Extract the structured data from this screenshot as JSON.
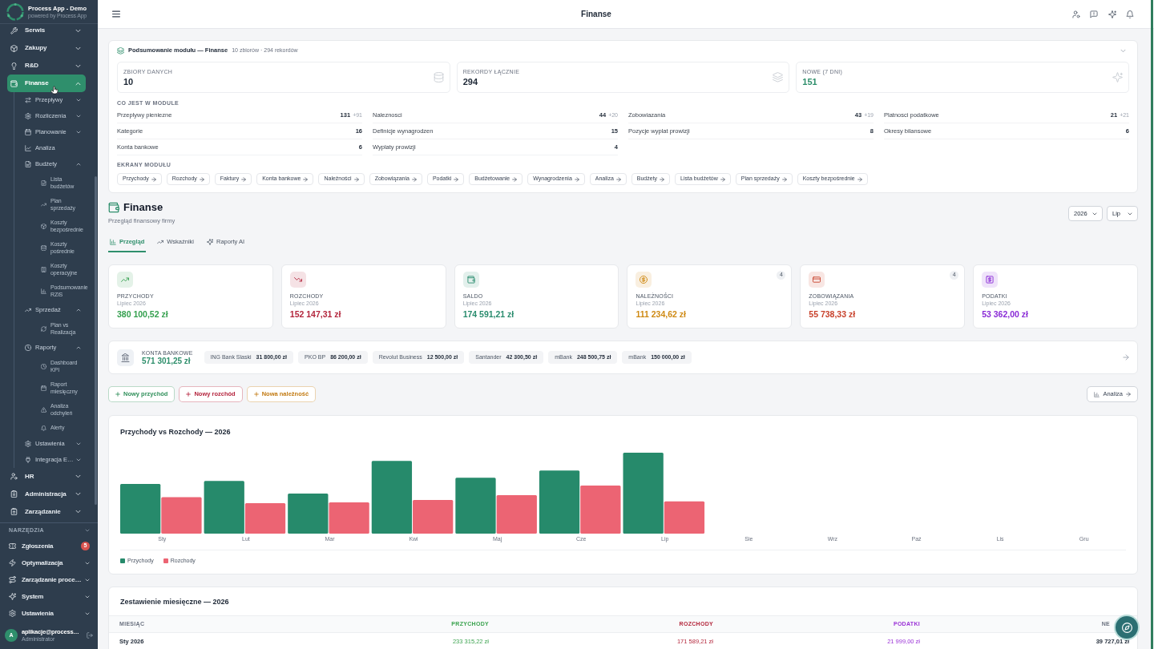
{
  "sidebar": {
    "app_title": "Process App - Demo",
    "app_subtitle": "powered by Process App",
    "nav": [
      {
        "label": "Serwis",
        "kind": "group",
        "expanded": false,
        "selected": false
      },
      {
        "label": "Zakupy",
        "kind": "group",
        "expanded": false,
        "selected": false
      },
      {
        "label": "R&D",
        "kind": "group",
        "expanded": false,
        "selected": false
      },
      {
        "label": "Finanse",
        "kind": "group",
        "expanded": true,
        "selected": true,
        "children": [
          {
            "label": "Przepływy",
            "kind": "group",
            "expanded": false,
            "selected": false
          },
          {
            "label": "Rozliczenia",
            "kind": "group",
            "expanded": false,
            "selected": false
          },
          {
            "label": "Planowanie",
            "kind": "group",
            "expanded": false,
            "selected": false
          },
          {
            "label": "Analiza",
            "kind": "link",
            "selected": false
          },
          {
            "label": "Budżety",
            "kind": "group",
            "expanded": true,
            "selected": false,
            "children": [
              {
                "label": "Lista budżetów",
                "kind": "link",
                "selected": false
              },
              {
                "label": "Plan sprzedaży",
                "kind": "link",
                "selected": false
              },
              {
                "label": "Koszty bezpośrednie",
                "kind": "link",
                "selected": false
              },
              {
                "label": "Koszty pośrednie",
                "kind": "link",
                "selected": false
              },
              {
                "label": "Koszty operacyjne",
                "kind": "link",
                "selected": false
              },
              {
                "label": "Podsumowanie RZiS",
                "kind": "link",
                "selected": false
              }
            ]
          },
          {
            "label": "Sprzedaż",
            "kind": "group",
            "expanded": true,
            "selected": false,
            "children": [
              {
                "label": "Plan vs Realizacja",
                "kind": "link",
                "selected": false
              }
            ]
          },
          {
            "label": "Raporty",
            "kind": "group",
            "expanded": true,
            "selected": false,
            "children": [
              {
                "label": "Dashboard KPI",
                "kind": "link",
                "selected": false
              },
              {
                "label": "Raport miesięczny",
                "kind": "link",
                "selected": false
              },
              {
                "label": "Analiza odchyleń",
                "kind": "link",
                "selected": false
              },
              {
                "label": "Alerty",
                "kind": "link",
                "selected": false
              }
            ]
          },
          {
            "label": "Ustawienia",
            "kind": "group",
            "expanded": false,
            "selected": false
          },
          {
            "label": "Integracja E…",
            "kind": "group",
            "expanded": false,
            "selected": false
          }
        ]
      },
      {
        "label": "HR",
        "kind": "group",
        "expanded": false,
        "selected": false
      },
      {
        "label": "Administracja",
        "kind": "group",
        "expanded": false,
        "selected": false
      },
      {
        "label": "Zarządzanie",
        "kind": "group",
        "expanded": false,
        "selected": false
      }
    ],
    "tools": {
      "label": "NARZĘDZIA",
      "items": [
        {
          "label": "Zgłoszenia",
          "kind": "link",
          "badge": "5",
          "selected": false
        },
        {
          "label": "Optymalizacja",
          "kind": "group",
          "expanded": false,
          "selected": false
        },
        {
          "label": "Zarządzanie proce…",
          "kind": "group",
          "expanded": false,
          "selected": false
        },
        {
          "label": "System",
          "kind": "group",
          "expanded": false,
          "selected": false
        },
        {
          "label": "Ustawienia",
          "kind": "group",
          "expanded": false,
          "selected": false
        }
      ]
    },
    "user": {
      "initial": "A",
      "email": "aplikacje@process…",
      "role": "Administrator"
    }
  },
  "topbar": {
    "title": "Finanse"
  },
  "module_summary": {
    "title": "Podsumowanie modułu — Finanse",
    "meta": "10 zbiorów · 294 rekordów",
    "stats": [
      {
        "label": "ZBIORY DANYCH",
        "value": "10",
        "color": "#1f2937"
      },
      {
        "label": "REKORDY ŁĄCZNIE",
        "value": "294",
        "color": "#1f2937"
      },
      {
        "label": "NOWE (7 DNI)",
        "value": "151",
        "color": "#2f8f6c"
      }
    ],
    "contents_label": "CO JEST W MODULE",
    "contents": [
      {
        "name": "Przeplywy pieniezne",
        "count": "131",
        "new": "+91"
      },
      {
        "name": "Naleznosci",
        "count": "44",
        "new": "+20"
      },
      {
        "name": "Zobowiazania",
        "count": "43",
        "new": "+19"
      },
      {
        "name": "Platnosci podatkowe",
        "count": "21",
        "new": "+21"
      },
      {
        "name": "Kategorie",
        "count": "16"
      },
      {
        "name": "Definicje wynagrodzen",
        "count": "15"
      },
      {
        "name": "Pozycje wyplat prowizji",
        "count": "8"
      },
      {
        "name": "Okresy bilansowe",
        "count": "6"
      },
      {
        "name": "Konta bankowe",
        "count": "6"
      },
      {
        "name": "Wyplaty prowizji",
        "count": "4"
      }
    ],
    "screens_label": "EKRANY MODUŁU",
    "screens": [
      "Przychody",
      "Rozchody",
      "Faktury",
      "Konta bankowe",
      "Należności",
      "Zobowiązania",
      "Podatki",
      "Budżetowanie",
      "Wynagrodzenia",
      "Analiza",
      "Budżety",
      "Lista budżetów",
      "Plan sprzedaży",
      "Koszty bezpośrednie"
    ]
  },
  "page_header": {
    "title": "Finanse",
    "subtitle": "Przegląd finansowy firmy",
    "year_select": "2026",
    "month_select": "Lip"
  },
  "tabs": [
    {
      "label": "Przegląd",
      "selected": true
    },
    {
      "label": "Wskaźniki",
      "selected": false
    },
    {
      "label": "Raporty AI",
      "selected": false
    }
  ],
  "kpi_cards": [
    {
      "label": "PRZYCHODY",
      "period": "Lipiec 2026",
      "value": "380 100,52 zł",
      "color": "#35a04f"
    },
    {
      "label": "ROZCHODY",
      "period": "Lipiec 2026",
      "value": "152 147,31 zł",
      "color": "#b3263d"
    },
    {
      "label": "SALDO",
      "period": "Lipiec 2026",
      "value": "174 591,21 zł",
      "color": "#2a8c6e"
    },
    {
      "label": "NALEŻNOŚCI",
      "period": "Lipiec 2026",
      "value": "111 234,62 zł",
      "color": "#cf8a14",
      "badge": "4"
    },
    {
      "label": "ZOBOWIĄZANIA",
      "period": "Lipiec 2026",
      "value": "55 738,33 zł",
      "color": "#c8412b",
      "badge": "4"
    },
    {
      "label": "PODATKI",
      "period": "Lipiec 2026",
      "value": "53 362,00 zł",
      "color": "#8a2bd6"
    }
  ],
  "bank_accounts": {
    "label": "KONTA BANKOWE",
    "total": "571 301,25 zł",
    "accounts": [
      {
        "name": "ING Bank Slaski",
        "amount": "31 800,00 zł"
      },
      {
        "name": "PKO BP",
        "amount": "86 200,00 zł"
      },
      {
        "name": "Revolut Business",
        "amount": "12 500,00 zł"
      },
      {
        "name": "Santander",
        "amount": "42 300,50 zł"
      },
      {
        "name": "mBank",
        "amount": "248 500,75 zł"
      },
      {
        "name": "mBank",
        "amount": "150 000,00 zł"
      }
    ]
  },
  "actions": [
    {
      "label": "Nowy przychód",
      "color": "#2f8f5a"
    },
    {
      "label": "Nowy rozchód",
      "color": "#b4233c"
    },
    {
      "label": "Nowa należność",
      "color": "#c27a12"
    }
  ],
  "analysis_button": {
    "label": "Analiza"
  },
  "chart": {
    "title": "Przychody vs Rozchody — 2026",
    "month_labels": [
      "Sty",
      "Lut",
      "Mar",
      "Kwi",
      "Maj",
      "Cze",
      "Lip",
      "Sie",
      "Wrz",
      "Paź",
      "Lis",
      "Gru"
    ],
    "legend": [
      {
        "label": "Przychody",
        "color": "#268a6b"
      },
      {
        "label": "Rozchody",
        "color": "#ec6473"
      }
    ]
  },
  "monthly_table": {
    "title": "Zestawienie miesięczne — 2026",
    "columns": [
      {
        "label": "MIESIĄC",
        "kind": "label",
        "color": "#6b7280"
      },
      {
        "label": "PRZYCHODY",
        "kind": "amount",
        "color": "#3ba34f"
      },
      {
        "label": "ROZCHODY",
        "kind": "amount",
        "color": "#b4283d"
      },
      {
        "label": "PODATKI",
        "kind": "amount",
        "color": "#9a31d6"
      },
      {
        "label": "NE",
        "kind": "total",
        "color": "#6b7280"
      }
    ],
    "rows": [
      [
        "Sty 2026",
        "233 315,22 zł",
        "171 589,21 zł",
        "21 999,00 zł",
        "39 727,01 zł"
      ]
    ]
  }
}
